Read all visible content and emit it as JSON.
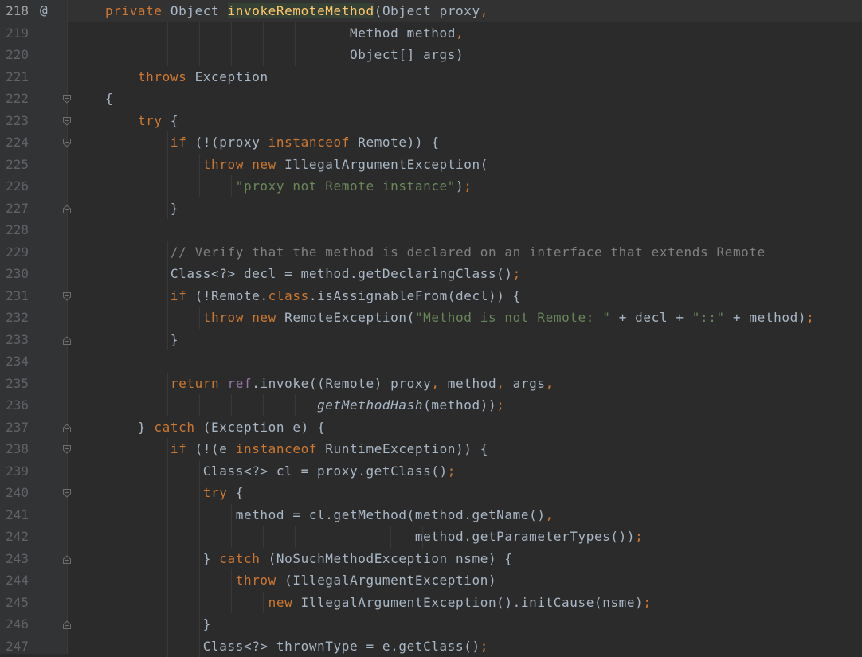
{
  "editor": {
    "language": "java",
    "colors": {
      "background": "#2b2b2b",
      "gutter": "#313335",
      "keyword": "#cc7832",
      "string": "#6a8759",
      "comment": "#808080",
      "method_decl": "#ffc66d",
      "field": "#9876aa",
      "text": "#a9b7c6",
      "line_number": "#606366"
    },
    "current_line": "218",
    "lines": [
      {
        "num": "218",
        "marker": "@",
        "fold": "",
        "text": "    private Object invokeRemoteMethod(Object proxy,"
      },
      {
        "num": "219",
        "marker": "",
        "fold": "",
        "text": "                                  Method method,"
      },
      {
        "num": "220",
        "marker": "",
        "fold": "",
        "text": "                                  Object[] args)"
      },
      {
        "num": "221",
        "marker": "",
        "fold": "",
        "text": "        throws Exception"
      },
      {
        "num": "222",
        "marker": "",
        "fold": "open",
        "text": "    {"
      },
      {
        "num": "223",
        "marker": "",
        "fold": "open",
        "text": "        try {"
      },
      {
        "num": "224",
        "marker": "",
        "fold": "open",
        "text": "            if (!(proxy instanceof Remote)) {"
      },
      {
        "num": "225",
        "marker": "",
        "fold": "",
        "text": "                throw new IllegalArgumentException("
      },
      {
        "num": "226",
        "marker": "",
        "fold": "",
        "text": "                    \"proxy not Remote instance\");"
      },
      {
        "num": "227",
        "marker": "",
        "fold": "close",
        "text": "            }"
      },
      {
        "num": "228",
        "marker": "",
        "fold": "",
        "text": ""
      },
      {
        "num": "229",
        "marker": "",
        "fold": "",
        "text": "            // Verify that the method is declared on an interface that extends Remote"
      },
      {
        "num": "230",
        "marker": "",
        "fold": "",
        "text": "            Class<?> decl = method.getDeclaringClass();"
      },
      {
        "num": "231",
        "marker": "",
        "fold": "open",
        "text": "            if (!Remote.class.isAssignableFrom(decl)) {"
      },
      {
        "num": "232",
        "marker": "",
        "fold": "",
        "text": "                throw new RemoteException(\"Method is not Remote: \" + decl + \"::\" + method);"
      },
      {
        "num": "233",
        "marker": "",
        "fold": "close",
        "text": "            }"
      },
      {
        "num": "234",
        "marker": "",
        "fold": "",
        "text": ""
      },
      {
        "num": "235",
        "marker": "",
        "fold": "",
        "text": "            return ref.invoke((Remote) proxy, method, args,"
      },
      {
        "num": "236",
        "marker": "",
        "fold": "",
        "text": "                              getMethodHash(method));"
      },
      {
        "num": "237",
        "marker": "",
        "fold": "close",
        "text": "        } catch (Exception e) {"
      },
      {
        "num": "238",
        "marker": "",
        "fold": "open",
        "text": "            if (!(e instanceof RuntimeException)) {"
      },
      {
        "num": "239",
        "marker": "",
        "fold": "",
        "text": "                Class<?> cl = proxy.getClass();"
      },
      {
        "num": "240",
        "marker": "",
        "fold": "open",
        "text": "                try {"
      },
      {
        "num": "241",
        "marker": "",
        "fold": "",
        "text": "                    method = cl.getMethod(method.getName(),"
      },
      {
        "num": "242",
        "marker": "",
        "fold": "",
        "text": "                                          method.getParameterTypes());"
      },
      {
        "num": "243",
        "marker": "",
        "fold": "close",
        "text": "                } catch (NoSuchMethodException nsme) {"
      },
      {
        "num": "244",
        "marker": "",
        "fold": "",
        "text": "                    throw (IllegalArgumentException)"
      },
      {
        "num": "245",
        "marker": "",
        "fold": "",
        "text": "                        new IllegalArgumentException().initCause(nsme);"
      },
      {
        "num": "246",
        "marker": "",
        "fold": "close",
        "text": "                }"
      },
      {
        "num": "247",
        "marker": "",
        "fold": "",
        "text": "                Class<?> thrownType = e.getClass();"
      }
    ]
  }
}
